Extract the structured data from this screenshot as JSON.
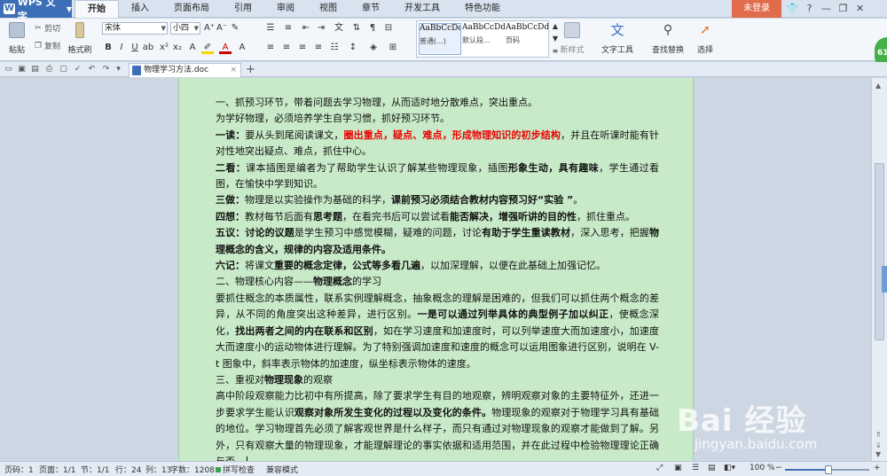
{
  "app": {
    "name": "WPS 文字",
    "logo": "W"
  },
  "menu": {
    "tabs": [
      "开始",
      "插入",
      "页面布局",
      "引用",
      "审阅",
      "视图",
      "章节",
      "开发工具",
      "特色功能"
    ],
    "active_tab": "开始",
    "login_label": "未登录"
  },
  "ribbon": {
    "paste_label": "粘贴",
    "cut_label": "剪切",
    "copy_label": "复制",
    "format_painter_label": "格式刷",
    "font_name": "宋体",
    "font_size": "小四",
    "styles": [
      {
        "sample": "AaBbCcDd",
        "name": "普通(...)"
      },
      {
        "sample": "AaBbCcDd",
        "name": "默认段..."
      },
      {
        "sample": "AaBbCcDd",
        "name": "页码"
      }
    ],
    "new_style_label": "新样式",
    "text_tools_label": "文字工具",
    "find_replace_label": "查找替换",
    "select_label": "选择"
  },
  "document": {
    "tab_title": "物理学习方法.doc",
    "paragraphs": [
      [
        {
          "t": "一、抓预习环节，带着问题去学习物理，从而适时地分散难点，突出重点。"
        }
      ],
      [
        {
          "t": "为学好物理，必须培养学生自学习惯，抓好预习环节。"
        }
      ],
      [
        {
          "t": "一读：",
          "b": true
        },
        {
          "t": "要从头到尾阅读课文，"
        },
        {
          "t": "圈出重点，疑点、难点，形成物理知识的初步结构",
          "red": true
        },
        {
          "t": "，并且在听课时能有针对性地突出疑点、难点，抓住中心。"
        }
      ],
      [
        {
          "t": "二看：",
          "b": true
        },
        {
          "t": "课本插图是编者为了帮助学生认识了解某些物理现象，插图"
        },
        {
          "t": "形象生动，具有趣味",
          "b": true
        },
        {
          "t": "，学生通过看图，在愉快中学到知识。"
        }
      ],
      [
        {
          "t": "三做：",
          "b": true
        },
        {
          "t": "物理是以实验操作为基础的科学，"
        },
        {
          "t": "课前预习必须结合教材内容预习好“实验 ”",
          "b": true
        },
        {
          "t": "。"
        }
      ],
      [
        {
          "t": "四想：",
          "b": true
        },
        {
          "t": "教材每节后面有"
        },
        {
          "t": "思考题",
          "b": true
        },
        {
          "t": "，在看完书后可以尝试看"
        },
        {
          "t": "能否解决，增强听讲的目的性",
          "b": true
        },
        {
          "t": "，抓住重点。"
        }
      ],
      [
        {
          "t": "五议：",
          "b": true
        },
        {
          "t": "讨论的议题",
          "b": true
        },
        {
          "t": "是学生预习中感觉模糊，疑难的问题，讨论"
        },
        {
          "t": "有助于学生重读教材",
          "b": true
        },
        {
          "t": "，深入思考，把握"
        },
        {
          "t": "物理概念的含义，规律的内容及适用条件。",
          "b": true
        }
      ],
      [
        {
          "t": "六记：",
          "b": true
        },
        {
          "t": "将课文"
        },
        {
          "t": "重要的概念定律，公式等多看几遍",
          "b": true
        },
        {
          "t": "，以加深理解，以便在此基础上加强记忆。"
        }
      ],
      [
        {
          "t": "二、物理核心内容——"
        },
        {
          "t": "物理概念",
          "b": true
        },
        {
          "t": "的学习"
        }
      ],
      [
        {
          "t": "要抓住概念的本质属性，联系实例理解概念，抽象概念的理解是困难的，但我们可以抓住两个概念的差异，从不同的角度突出这种差异，进行区别。"
        },
        {
          "t": "一是可以通过列举具体的典型例子加以纠正",
          "b": true
        },
        {
          "t": "，使概念深化，"
        },
        {
          "t": "找出两者之间的内在联系和区别",
          "b": true
        },
        {
          "t": "，如在学习速度和加速度时，可以列举速度大而加速度小，加速度大而速度小的运动物体进行理解。为了特别强调加速度和速度的概念可以运用图象进行区别，说明在 V-t 图象中，斜率表示物体的加速度，纵坐标表示物体的速度。"
        }
      ],
      [
        {
          "t": "三、重视对"
        },
        {
          "t": "物理现象",
          "b": true
        },
        {
          "t": "的观察"
        }
      ],
      [
        {
          "t": "高中阶段观察能力比初中有所提高，除了要求学生有目的地观察，辨明观察对象的主要特征外，还进一步要求学生能认识"
        },
        {
          "t": "观察对象所发生变化的过程以及变化的条件。",
          "b": true
        },
        {
          "t": "物理现象的观察对于物理学习具有基础的地位。学习物理首先必须了解客观世界是什么样子，而只有通过对物理现象的观察才能做到了解。另外，只有观察大量的物理现象，才能理解理论的事实依据和适用范围，并在此过程中检验物理理论正确与否。"
        }
      ]
    ]
  },
  "status": {
    "page_num": "页码：1",
    "page_of": "页面：1/1",
    "section": "节：1/1",
    "row": "行：24",
    "col": "列：13",
    "word_count": "字数：1208",
    "spell_check": "拼写检查",
    "compat_mode": "兼容模式",
    "zoom": "100 %",
    "zoom_fraction": 0.52
  },
  "badge_text": "61",
  "watermark": {
    "main": "Bai 经验",
    "sub": "jingyan.baidu.com"
  },
  "colors": {
    "page_bg": "#c8eac8",
    "accent": "#3c6fb8",
    "login": "#e06c4c",
    "emphasis_red": "#e00000"
  },
  "icons": [
    "paste-icon",
    "cut-icon",
    "copy-icon",
    "format-painter-icon",
    "text-tools-icon",
    "find-replace-icon",
    "select-cursor-icon"
  ]
}
